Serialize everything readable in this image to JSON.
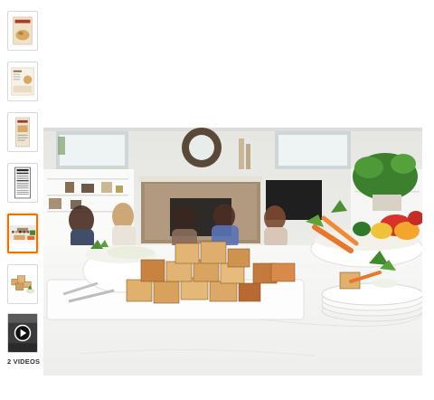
{
  "gallery": {
    "thumbnails": [
      {
        "icon": "package-front-thumb"
      },
      {
        "icon": "recipe-card-thumb"
      },
      {
        "icon": "package-side-thumb"
      },
      {
        "icon": "nutrition-label-thumb"
      },
      {
        "icon": "party-scene-thumb",
        "selected": true
      },
      {
        "icon": "bread-cubes-thumb"
      }
    ],
    "video": {
      "icon": "play-icon",
      "count_label": "2 VIDEOS"
    },
    "accent_color": "#e77600"
  },
  "main_image": {
    "subject": "party-scene-photo"
  }
}
